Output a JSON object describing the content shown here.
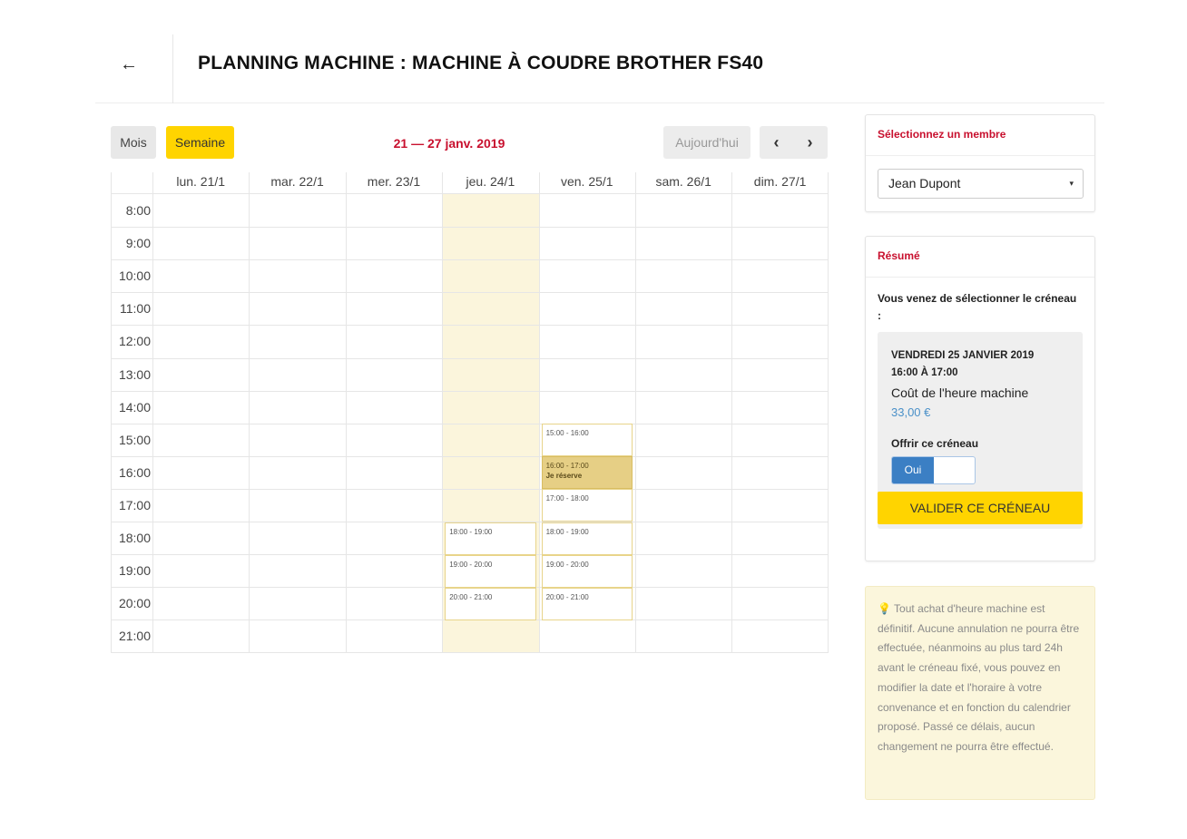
{
  "header": {
    "back_icon": "←",
    "title": "PLANNING MACHINE : MACHINE À COUDRE BROTHER FS40"
  },
  "toolbar": {
    "month_label": "Mois",
    "week_label": "Semaine",
    "date_range": "21 — 27 janv. 2019",
    "today_label": "Aujourd'hui",
    "prev_icon": "‹",
    "next_icon": "›"
  },
  "calendar": {
    "days": [
      "lun. 21/1",
      "mar. 22/1",
      "mer. 23/1",
      "jeu. 24/1",
      "ven. 25/1",
      "sam. 26/1",
      "dim. 27/1"
    ],
    "today_index": 3,
    "hours": [
      "8:00",
      "9:00",
      "10:00",
      "11:00",
      "12:00",
      "13:00",
      "14:00",
      "15:00",
      "16:00",
      "17:00",
      "18:00",
      "19:00",
      "20:00",
      "21:00"
    ],
    "slots": [
      {
        "day": 3,
        "hour": 10,
        "label": "18:00 - 19:00"
      },
      {
        "day": 3,
        "hour": 11,
        "label": "19:00 - 20:00"
      },
      {
        "day": 3,
        "hour": 12,
        "label": "20:00 - 21:00"
      },
      {
        "day": 4,
        "hour": 7,
        "label": "15:00 - 16:00"
      },
      {
        "day": 4,
        "hour": 8,
        "label": "16:00 - 17:00",
        "sub": "Je réserve",
        "selected": true
      },
      {
        "day": 4,
        "hour": 9,
        "label": "17:00 - 18:00"
      },
      {
        "day": 4,
        "hour": 10,
        "label": "18:00 - 19:00"
      },
      {
        "day": 4,
        "hour": 11,
        "label": "19:00 - 20:00"
      },
      {
        "day": 4,
        "hour": 12,
        "label": "20:00 - 21:00"
      }
    ]
  },
  "member_panel": {
    "title": "Sélectionnez un membre",
    "selected_member": "Jean Dupont",
    "caret_icon": "▾"
  },
  "resume_panel": {
    "title": "Résumé",
    "intro": "Vous venez de sélectionner le créneau :",
    "slot_date": "VENDREDI 25 JANVIER 2019",
    "slot_time": "16:00 À 17:00",
    "cost_label": "Coût de l'heure machine",
    "cost_value": "33,00 €",
    "offer_label": "Offrir ce créneau",
    "toggle_on_label": "Oui",
    "toggle_value": true,
    "validate_label": "VALIDER CE CRÉNEAU"
  },
  "note": {
    "icon": "lightbulb-icon",
    "text": "💡 Tout achat d'heure machine est définitif. Aucune annulation ne pourra être effectuée, néanmoins au plus tard 24h avant le créneau fixé, vous pouvez en modifier la date et l'horaire à votre convenance et en fonction du calendrier proposé. Passé ce délais, aucun changement ne pourra être effectué."
  },
  "colors": {
    "accent_yellow": "#ffd400",
    "title_red": "#c8102e",
    "toggle_blue": "#3b7fc4",
    "today_bg": "#fbf5dc",
    "selected_slot": "#e6cf85"
  }
}
